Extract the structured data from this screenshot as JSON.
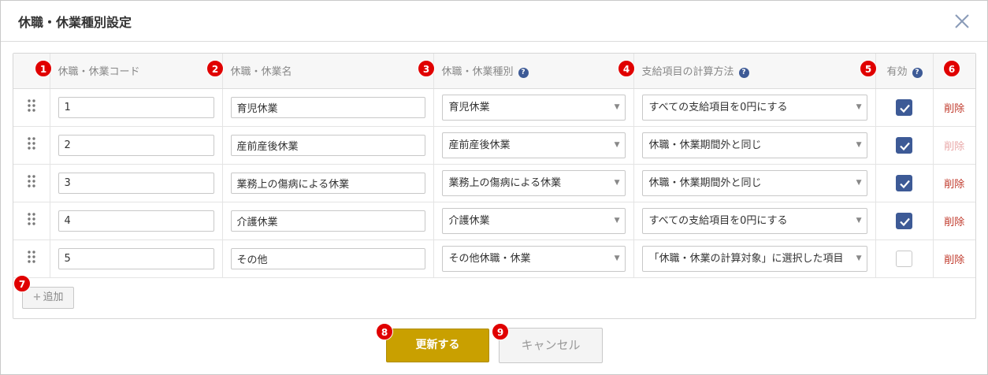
{
  "dialog": {
    "title": "休職・休業種別設定",
    "close_icon": "close-icon"
  },
  "columns": [
    {
      "label": "休職・休業コード",
      "help": false
    },
    {
      "label": "休職・休業名",
      "help": false
    },
    {
      "label": "休職・休業種別",
      "help": true
    },
    {
      "label": "支給項目の計算方法",
      "help": true
    },
    {
      "label": "有効",
      "help": true
    },
    {
      "label": "",
      "help": false
    }
  ],
  "help_glyph": "?",
  "callouts": [
    "1",
    "2",
    "3",
    "4",
    "5",
    "6",
    "7",
    "8",
    "9"
  ],
  "rows": [
    {
      "code": "1",
      "name": "育児休業",
      "type": "育児休業",
      "calc": "すべての支給項目を0円にする",
      "enabled": true,
      "delete": "削除",
      "delete_enabled": true
    },
    {
      "code": "2",
      "name": "産前産後休業",
      "type": "産前産後休業",
      "calc": "休職・休業期間外と同じ",
      "enabled": true,
      "delete": "削除",
      "delete_enabled": false
    },
    {
      "code": "3",
      "name": "業務上の傷病による休業",
      "type": "業務上の傷病による休業",
      "calc": "休職・休業期間外と同じ",
      "enabled": true,
      "delete": "削除",
      "delete_enabled": true
    },
    {
      "code": "4",
      "name": "介護休業",
      "type": "介護休業",
      "calc": "すべての支給項目を0円にする",
      "enabled": true,
      "delete": "削除",
      "delete_enabled": true
    },
    {
      "code": "5",
      "name": "その他",
      "type": "その他休職・休業",
      "calc": "「休職・休業の計算対象」に選択した項目",
      "enabled": false,
      "delete": "削除",
      "delete_enabled": true
    }
  ],
  "buttons": {
    "add": "追加",
    "update": "更新する",
    "cancel": "キャンセル"
  },
  "colors": {
    "accent": "#3d5a96",
    "primary_button": "#c9a000",
    "delete_text": "#c0392b",
    "callout": "#e00000"
  }
}
